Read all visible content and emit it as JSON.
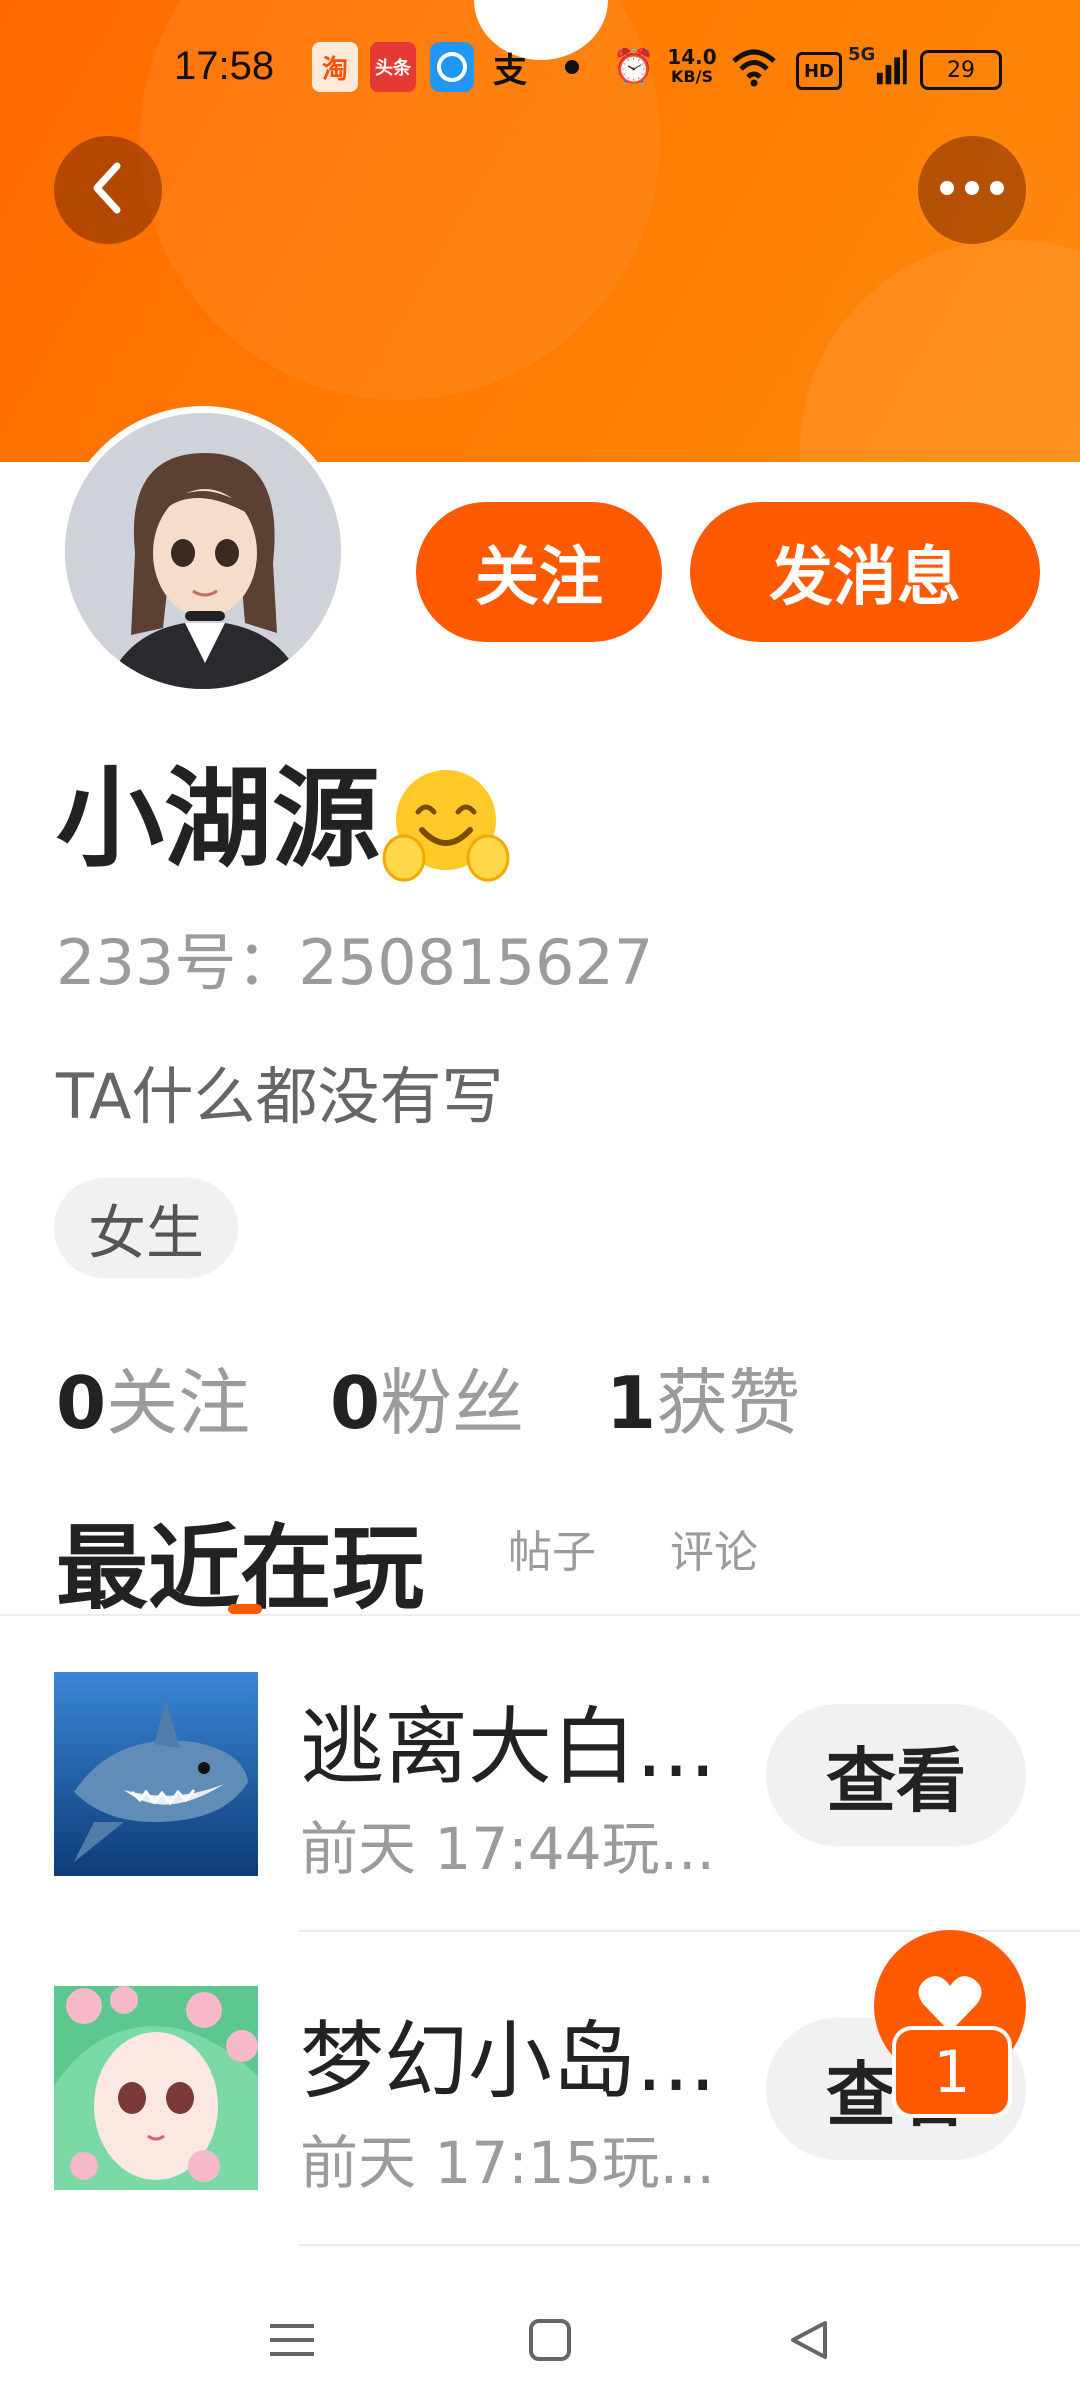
{
  "status_bar": {
    "time": "17:58",
    "taobao_glyph": "淘",
    "toutiao_glyph": "头条",
    "pay_glyph": "支",
    "alarm_glyph": "⏰",
    "net_speed_value": "14.0",
    "net_speed_unit": "KB/S",
    "hd_label": "HD",
    "signal_label": "5G",
    "battery": "29"
  },
  "header": {
    "back_icon": "chevron-left-icon",
    "more_icon": "more-horizontal-icon"
  },
  "profile": {
    "follow_label": "关注",
    "message_label": "发消息",
    "name": "小湖源",
    "name_emoji": "hugging-face-emoji",
    "uid_text": "233号：250815627",
    "bio": "TA什么都没有写",
    "gender_tag": "女生"
  },
  "stats": {
    "following_count": "0",
    "following_label": "关注",
    "fans_count": "0",
    "fans_label": "粉丝",
    "likes_count": "1",
    "likes_label": "获赞"
  },
  "tabs": {
    "recent_label": "最近在玩",
    "posts_label": "帖子",
    "comments_label": "评论"
  },
  "games": [
    {
      "title": "逃离大白...",
      "time": "前天 17:44玩...",
      "button": "查看"
    },
    {
      "title": "梦幻小岛...",
      "time": "前天 17:15玩...",
      "button": "查看"
    }
  ],
  "floating": {
    "like_icon": "heart-icon",
    "like_badge": "1"
  },
  "navbar": {
    "menu_icon": "menu-icon",
    "home_icon": "square-home-icon",
    "back_icon": "triangle-back-icon"
  },
  "colors": {
    "accent": "#ff5a00",
    "banner": "#ff7a00",
    "muted_text": "#9b9b9b"
  }
}
